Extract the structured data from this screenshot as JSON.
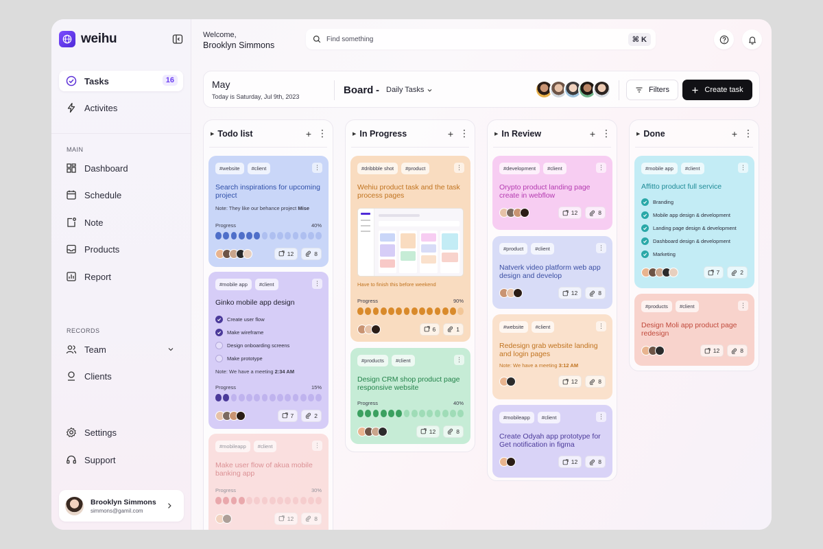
{
  "brand": {
    "name": "weihu"
  },
  "nav": {
    "tasks_label": "Tasks",
    "tasks_count": "16",
    "activities_label": "Activites",
    "main_section": "MAIN",
    "dashboard_label": "Dashboard",
    "schedule_label": "Schedule",
    "note_label": "Note",
    "products_label": "Products",
    "report_label": "Report",
    "records_section": "RECORDS",
    "team_label": "Team",
    "clients_label": "Clients",
    "settings_label": "Settings",
    "support_label": "Support"
  },
  "user": {
    "name": "Brooklyn Simmons",
    "email": "simmons@gamil.com"
  },
  "header": {
    "welcome": "Welcome,",
    "user_name": "Brooklyn Simmons",
    "search_placeholder": "Find something",
    "shortcut": "⌘ K"
  },
  "toolbar": {
    "month": "May",
    "today": "Today is Saturday, Jul 9th, 2023",
    "board_title": "Board",
    "board_dash": "-",
    "view": "Daily Tasks",
    "filters_label": "Filters",
    "create_label": "Create task"
  },
  "columns": [
    {
      "title": "Todo list"
    },
    {
      "title": "In Progress"
    },
    {
      "title": "In Review"
    },
    {
      "title": "Done"
    }
  ],
  "cards": {
    "todo1": {
      "tag1": "#website",
      "tag2": "#client",
      "title": "Search inspirations for upcoming project",
      "note_prefix": "Note:  They like our behance project",
      "note_bold": "Mise",
      "progress_label": "Progress",
      "progress_text": "40%",
      "progress": 0.4,
      "subtasks": "12",
      "attachments": "8"
    },
    "todo2": {
      "tag1": "#mobile app",
      "tag2": "#client",
      "title": "Ginko mobile app design",
      "checklist": [
        "Create user flow",
        "Make wireframe",
        "Design onboarding screens",
        "Make prototype"
      ],
      "checked": [
        true,
        true,
        false,
        false
      ],
      "note_prefix": "Note:  We have a meeting",
      "note_bold": "2:34 AM",
      "progress_label": "Progress",
      "progress_text": "15%",
      "progress": 0.15,
      "subtasks": "7",
      "attachments": "2"
    },
    "todo3": {
      "tag1": "#mobileapp",
      "tag2": "#client",
      "title": "Make user flow of akua mobile banking app",
      "progress_label": "Progress",
      "progress_text": "30%",
      "progress": 0.3,
      "subtasks": "12",
      "attachments": "8"
    },
    "prog1": {
      "tag1": "#dribbble shot",
      "tag2": "#product",
      "title": "Wehiu product task and the task process pages",
      "note": "Have to finish this before weekend",
      "progress_label": "Progress",
      "progress_text": "90%",
      "progress": 0.9,
      "subtasks": "6",
      "attachments": "1"
    },
    "prog2": {
      "tag1": "#products",
      "tag2": "#client",
      "title": "Design CRM shop product page responsive website",
      "progress_label": "Progress",
      "progress_text": "40%",
      "progress": 0.4,
      "subtasks": "12",
      "attachments": "8"
    },
    "rev1": {
      "tag1": "#development",
      "tag2": "#client",
      "title": "Orypto product landing  page create in webflow",
      "subtasks": "12",
      "attachments": "8"
    },
    "rev2": {
      "tag1": "#product",
      "tag2": "#client",
      "title": "Natverk video platform web app design and develop",
      "subtasks": "12",
      "attachments": "8"
    },
    "rev3": {
      "tag1": "#website",
      "tag2": "#client",
      "title": "Redesign grab website landing and login pages",
      "note_prefix": "Note:  We have a meeting",
      "note_bold": "3:12 AM",
      "subtasks": "12",
      "attachments": "8"
    },
    "rev4": {
      "tag1": "#mobileapp",
      "tag2": "#client",
      "title": "Create Odyah app prototype for Get notification in figma",
      "subtasks": "12",
      "attachments": "8"
    },
    "done1": {
      "tag1": "#mobile app",
      "tag2": "#client",
      "title": "Affitto product full service",
      "checklist": [
        "Branding",
        "Mobile app design & development",
        "Landing page design & development",
        "Dashboard design & development",
        "Marketing"
      ],
      "subtasks": "7",
      "attachments": "2"
    },
    "done2": {
      "tag1": "#products",
      "tag2": "#client",
      "title": "Design Moli app product page redesign",
      "subtasks": "12",
      "attachments": "8"
    }
  },
  "colors": {
    "accent": "#6b3ff0",
    "blue_card": "#c9d6f8",
    "blue_dot": "#4f6fc9",
    "purple_card": "#d6cdf7",
    "purple_dot": "#4b3a9a",
    "red_card": "#f8c9c7",
    "red_dot": "#d9666b",
    "orange_card": "#f9dcc0",
    "orange_dot": "#d98a2b",
    "green_card": "#c6ecd6",
    "green_dot": "#3ba060",
    "pink_card": "#f7cdf2",
    "lavender_card": "#d8dcf7",
    "peach_card": "#fae1cc",
    "violet_card": "#d9d3f7",
    "cyan_card": "#c3ecf5",
    "cyan_check": "#2aa8a8",
    "salmon_card": "#f8d3cc"
  }
}
